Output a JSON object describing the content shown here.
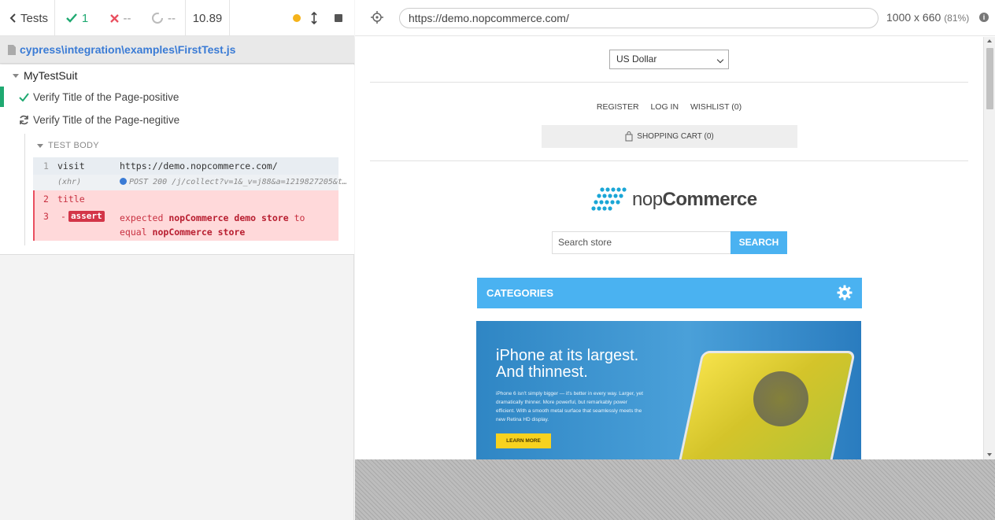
{
  "reporter": {
    "tests_label": "Tests",
    "passed_count": "1",
    "failed_count": "--",
    "pending_count": "--",
    "duration": "10.89",
    "spec_path": "cypress\\integration\\examples\\FirstTest.js",
    "suite_name": "MyTestSuit",
    "tests": [
      {
        "title": "Verify Title of the Page-positive",
        "state": "passed"
      },
      {
        "title": "Verify Title of the Page-negitive",
        "state": "running"
      }
    ],
    "test_body_label": "TEST BODY",
    "commands": [
      {
        "num": "1",
        "name": "visit",
        "message": "https://demo.nopcommerce.com/"
      },
      {
        "num": "",
        "name": "(xhr)",
        "message": "POST 200 /j/collect?v=1&_v=j88&a=1219827205&t…"
      },
      {
        "num": "2",
        "name": "title",
        "message": ""
      },
      {
        "num": "3",
        "name": "assert",
        "message_pre": "expected ",
        "message_actual": "nopCommerce demo store",
        "message_mid": " to equal ",
        "message_expected": "nopCommerce store"
      }
    ]
  },
  "aut": {
    "url": "https://demo.nopcommerce.com/",
    "viewport": "1000 x 660",
    "scale": "(81%)",
    "page": {
      "currency": "US Dollar",
      "links": [
        "REGISTER",
        "LOG IN",
        "WISHLIST (0)"
      ],
      "cart": "SHOPPING CART (0)",
      "logo_light": "nop",
      "logo_bold": "Commerce",
      "search_placeholder": "Search store",
      "search_button": "SEARCH",
      "categories": "CATEGORIES",
      "banner_title_1": "iPhone at its largest.",
      "banner_title_2": "And thinnest.",
      "banner_text": "iPhone 6 isn't simply bigger — it's better in every way. Larger, yet dramatically thinner. More powerful, but remarkably power efficient. With a smooth metal surface that seamlessly meets the new Retina HD display.",
      "banner_button": "LEARN MORE"
    }
  },
  "colors": {
    "passed": "#1fa971",
    "failed": "#e94f5f",
    "accent": "#4ab2f1",
    "link": "#3a7bd5"
  }
}
